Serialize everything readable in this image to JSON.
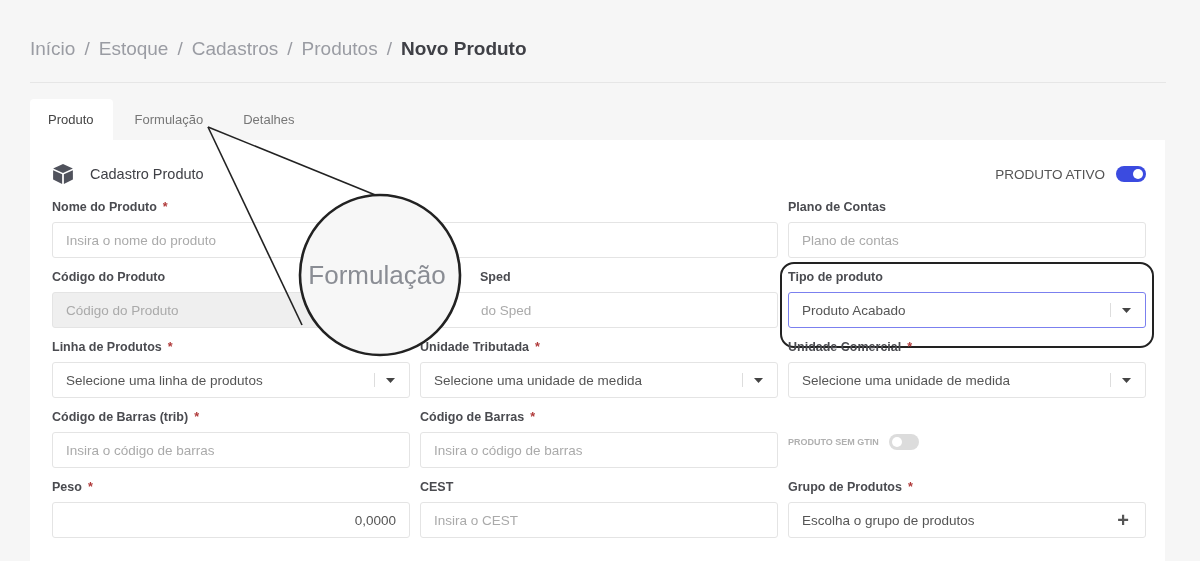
{
  "breadcrumb": {
    "separator": "/",
    "items": [
      {
        "label": "Início",
        "current": false
      },
      {
        "label": "Estoque",
        "current": false
      },
      {
        "label": "Cadastros",
        "current": false
      },
      {
        "label": "Produtos",
        "current": false
      },
      {
        "label": "Novo Produto",
        "current": true
      }
    ]
  },
  "tabs": [
    {
      "label": "Produto",
      "selected": true
    },
    {
      "label": "Formulação",
      "selected": false
    },
    {
      "label": "Detalhes",
      "selected": false
    }
  ],
  "section": {
    "title": "Cadastro Produto",
    "active_label": "PRODUTO ATIVO",
    "active": true
  },
  "fields": [
    {
      "kind": "text",
      "label": "Nome do Produto",
      "required_mark": "*",
      "wide": true,
      "placeholder": "Insira o nome do produto"
    },
    {
      "kind": "text",
      "label": "Plano de Contas",
      "placeholder": "Plano de contas"
    },
    {
      "kind": "disabled",
      "label": "Código do Produto",
      "placeholder": "Código do Produto"
    },
    {
      "kind": "text",
      "label": "Sped",
      "covered": true,
      "placeholder": "do Sped"
    },
    {
      "kind": "select",
      "label": "Tipo de produto",
      "highlighted": true,
      "value": "Produto Acabado"
    },
    {
      "kind": "select",
      "label": "Linha de Produtos",
      "required_mark": "*",
      "value": "Selecione uma linha de produtos"
    },
    {
      "kind": "select",
      "label": "Unidade Tributada",
      "required_mark": "*",
      "value": "Selecione uma unidade de medida"
    },
    {
      "kind": "select",
      "label": "Unidade Comercial",
      "required_mark": "*",
      "value": "Selecione uma unidade de medida"
    },
    {
      "kind": "text",
      "label": "Código de Barras (trib)",
      "required_mark": "*",
      "placeholder": "Insira o código de barras"
    },
    {
      "kind": "text",
      "label": "Código de Barras",
      "required_mark": "*",
      "placeholder": "Insira o código de barras"
    },
    {
      "kind": "toggle",
      "label": "PRODUTO SEM GTIN",
      "on": false
    },
    {
      "kind": "number",
      "label": "Peso",
      "required_mark": "*",
      "value": "0,0000"
    },
    {
      "kind": "text",
      "label": "CEST",
      "placeholder": "Insira o CEST"
    },
    {
      "kind": "add-select",
      "label": "Grupo de Produtos",
      "required_mark": "*",
      "value": "Escolha o grupo de produtos",
      "action": "+"
    }
  ],
  "callout": {
    "text": "Formulação"
  }
}
